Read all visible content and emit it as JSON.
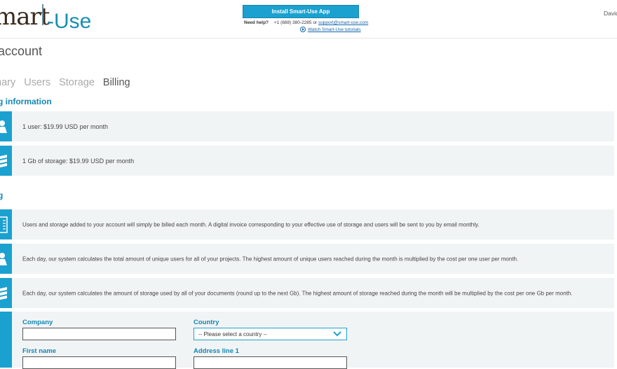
{
  "header": {
    "logo_part1": "mart",
    "logo_part2": "Use",
    "install_button": "Install Smart-Use App",
    "help_label": "Need help?",
    "help_phone": "+1 (888) 380-2285 or",
    "help_email": "support@smart-use.com",
    "tutorials_link": "Watch Smart-Use tutorials",
    "user_name": "David"
  },
  "page": {
    "title": "account"
  },
  "tabs": [
    {
      "label": "mary",
      "active": false
    },
    {
      "label": "Users",
      "active": false
    },
    {
      "label": "Storage",
      "active": false
    },
    {
      "label": "Billing",
      "active": true
    }
  ],
  "billing_info": {
    "title": "g information",
    "rows": [
      {
        "icon": "user-icon",
        "text": "1 user: $19.99 USD per month"
      },
      {
        "icon": "storage-icon",
        "text": "1 Gb of storage: $19.99 USD per month"
      }
    ]
  },
  "billing": {
    "title": "g",
    "rows": [
      {
        "icon": "invoice-icon",
        "text": "Users and storage added to your account will simply be billed each month. A digital invoice corresponding to your effective use of storage and users will be sent to you by email monthly."
      },
      {
        "icon": "user-icon",
        "text": "Each day, our system calculates the total amount of unique users for all of your projects. The highest amount of unique users reached during the month is multiplied by the cost per one user per month."
      },
      {
        "icon": "storage-icon",
        "text": "Each day, our system calculates the amount of storage used by all of your documents (round up to the next Gb). The highest amount of storage reached during the month will be multiplied by the cost per one Gb per month."
      }
    ]
  },
  "form": {
    "company_label": "Company",
    "company_value": "",
    "country_label": "Country",
    "country_selected": "-- Please select a country --",
    "first_name_label": "First name",
    "first_name_value": "",
    "address_label": "Address line 1",
    "address_value": ""
  },
  "colors": {
    "accent": "#1ba1cf",
    "title_blue": "#1486b3",
    "row_bg": "#f1f4f5"
  }
}
